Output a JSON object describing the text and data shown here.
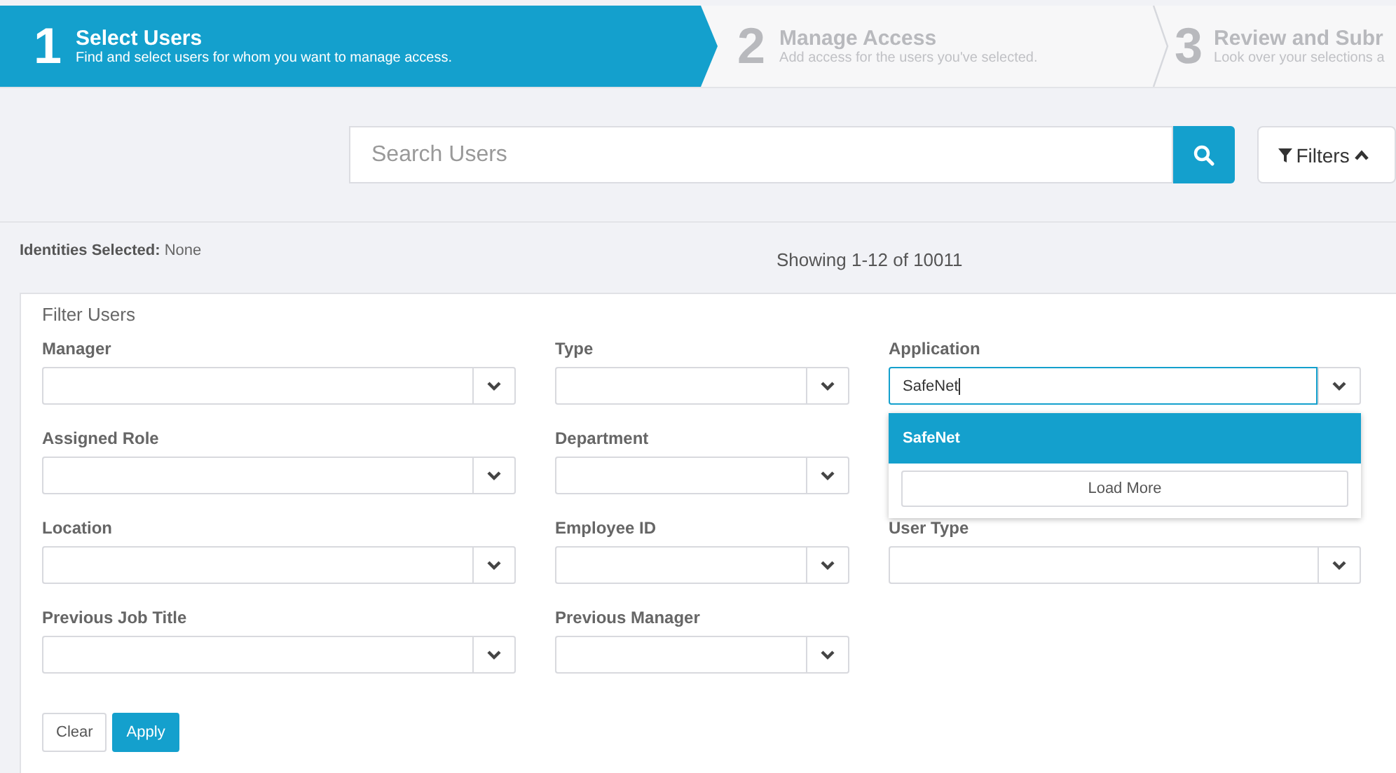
{
  "steps": [
    {
      "number": "1",
      "title": "Select Users",
      "subtitle": "Find and select users for whom you want to manage access.",
      "selected": true
    },
    {
      "number": "2",
      "title": "Manage Access",
      "subtitle": "Add access for the users you've selected.",
      "selected": false
    },
    {
      "number": "3",
      "title": "Review and Subr",
      "subtitle": "Look over your selections a",
      "selected": false
    }
  ],
  "search": {
    "placeholder": "Search Users"
  },
  "filters_button": {
    "label": "Filters",
    "expanded": true
  },
  "identities_selected": {
    "label": "Identities Selected:",
    "value": "None"
  },
  "showing": "Showing 1-12 of 10011",
  "filter_panel": {
    "title": "Filter Users",
    "fields": [
      {
        "label": "Manager",
        "focused": false
      },
      {
        "label": "Type",
        "focused": false
      },
      {
        "label": "Application",
        "value": "SafeNet",
        "focused": true,
        "dropdown": {
          "options": [
            {
              "label": "SafeNet",
              "selected": true
            }
          ],
          "button": "Load More"
        }
      },
      {
        "label": "Assigned Role",
        "focused": false
      },
      {
        "label": "Department",
        "focused": false
      },
      {
        "label": "Location",
        "focused": false
      },
      {
        "label": "Employee ID",
        "focused": false
      },
      {
        "label": "User Type",
        "focused": false
      },
      {
        "label": "Previous Job Title",
        "focused": false
      },
      {
        "label": "Previous Manager",
        "focused": false
      }
    ],
    "buttons": [
      {
        "label": "Clear",
        "kind": "secondary"
      },
      {
        "label": "Apply",
        "kind": "primary"
      }
    ]
  }
}
